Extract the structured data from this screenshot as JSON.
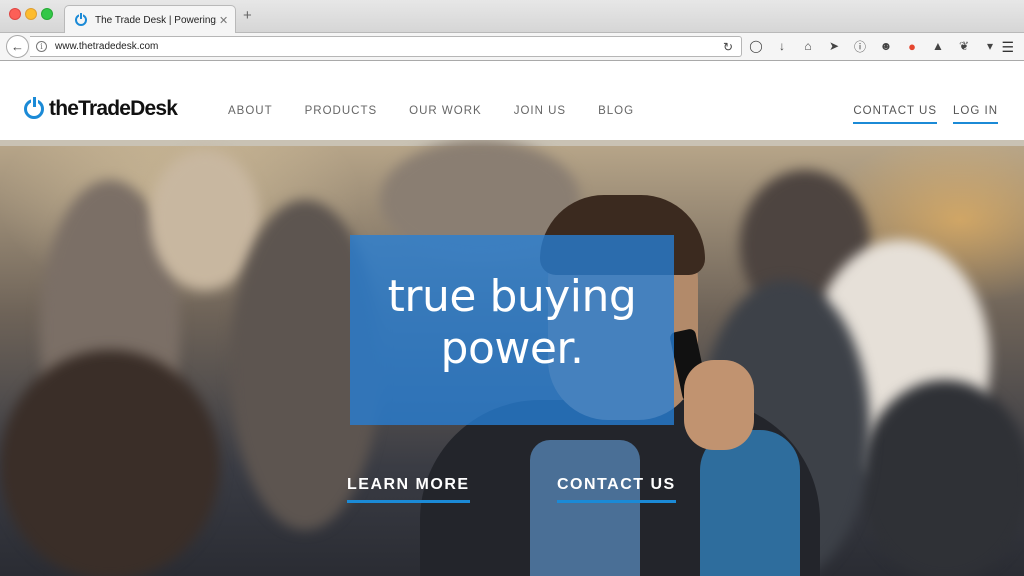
{
  "browser": {
    "tab_title": "The Trade Desk | Powering...",
    "tab_close": "✕",
    "new_tab": "+",
    "url": "www.thetradedesk.com"
  },
  "site": {
    "logo_text": "theTradeDesk",
    "nav": [
      "ABOUT",
      "PRODUCTS",
      "OUR WORK",
      "JOIN US",
      "BLOG"
    ],
    "right_nav": [
      "CONTACT US",
      "LOG IN"
    ]
  },
  "hero": {
    "headline_line1": "true buying",
    "headline_line2": "power.",
    "cta_learn": "LEARN MORE",
    "cta_contact": "CONTACT US"
  },
  "colors": {
    "accent": "#1b8ad6",
    "hero_box": "#277fd6"
  }
}
